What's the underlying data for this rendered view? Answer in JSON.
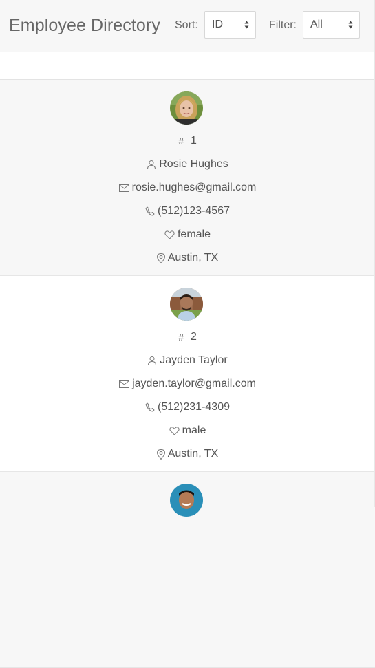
{
  "header": {
    "title": "Employee Directory",
    "sort_label": "Sort:",
    "sort_value": "ID",
    "filter_label": "Filter:",
    "filter_value": "All"
  },
  "employees": [
    {
      "id": "1",
      "name": "Rosie Hughes",
      "email": "rosie.hughes@gmail.com",
      "phone": "(512)123-4567",
      "gender": "female",
      "location": "Austin, TX"
    },
    {
      "id": "2",
      "name": "Jayden Taylor",
      "email": "jayden.taylor@gmail.com",
      "phone": "(512)231-4309",
      "gender": "male",
      "location": "Austin, TX"
    }
  ],
  "icons": {
    "id": "hash-icon",
    "name": "user-icon",
    "email": "envelope-icon",
    "phone": "phone-icon",
    "gender": "heart-icon",
    "location": "map-pin-icon"
  },
  "colors": {
    "header_bg": "#f7f7f7",
    "card_shaded_bg": "#f7f7f7",
    "text": "#555555"
  }
}
